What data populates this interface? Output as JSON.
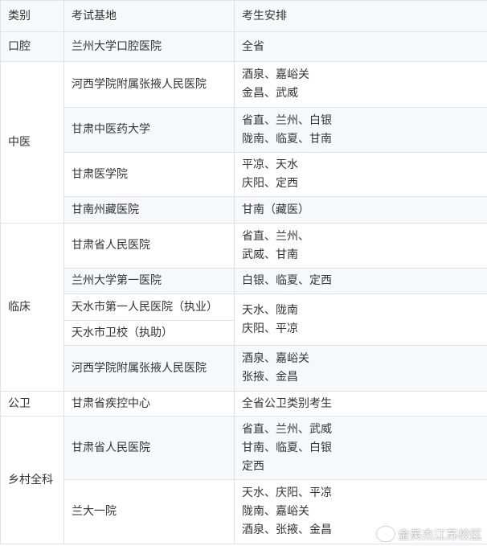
{
  "table": {
    "headers": [
      "类别",
      "考试基地",
      "考生安排"
    ],
    "rows": [
      {
        "category": "口腔",
        "base": "兰州大学口腔医院",
        "arrangement": [
          "全省"
        ]
      },
      {
        "category": "中医",
        "base": "河西学院附属张掖人民医院",
        "arrangement": [
          "酒泉、嘉峪关",
          "金昌、武威"
        ]
      },
      {
        "base": "甘肃中医药大学",
        "arrangement": [
          "省直、兰州、白银",
          "陇南、临夏、甘南"
        ]
      },
      {
        "base": "甘肃医学院",
        "arrangement": [
          "平凉、天水",
          "庆阳、定西"
        ]
      },
      {
        "base": "甘南州藏医院",
        "arrangement": [
          "甘南（藏医）"
        ]
      },
      {
        "category": "临床",
        "base": "甘肃省人民医院",
        "arrangement": [
          "省直、兰州、",
          "武威、甘南"
        ]
      },
      {
        "base": "兰州大学第一医院",
        "arrangement": [
          "白银、临夏、定西"
        ]
      },
      {
        "base": "天水市第一人民医院（执业）",
        "arrangement": [
          "天水、陇南",
          "庆阳、平凉"
        ]
      },
      {
        "base": "天水市卫校（执助）"
      },
      {
        "base": "河西学院附属张掖人民医院",
        "arrangement": [
          "酒泉、嘉峪关",
          "张掖、金昌"
        ]
      },
      {
        "category": "公卫",
        "base": "甘肃省疾控中心",
        "arrangement": [
          "全省公卫类别考生"
        ]
      },
      {
        "category": "乡村全科",
        "base": "甘肃省人民医院",
        "arrangement": [
          "省直、兰州、武威",
          "甘南、临夏、白银",
          "定西"
        ]
      },
      {
        "base": "兰大一院",
        "arrangement": [
          "天水、庆阳、平凉",
          "陇南、嘉峪关",
          "酒泉、张掖、金昌"
        ]
      }
    ]
  },
  "watermark": {
    "text": "金英杰江苏校区",
    "icon": "weibo-icon"
  }
}
